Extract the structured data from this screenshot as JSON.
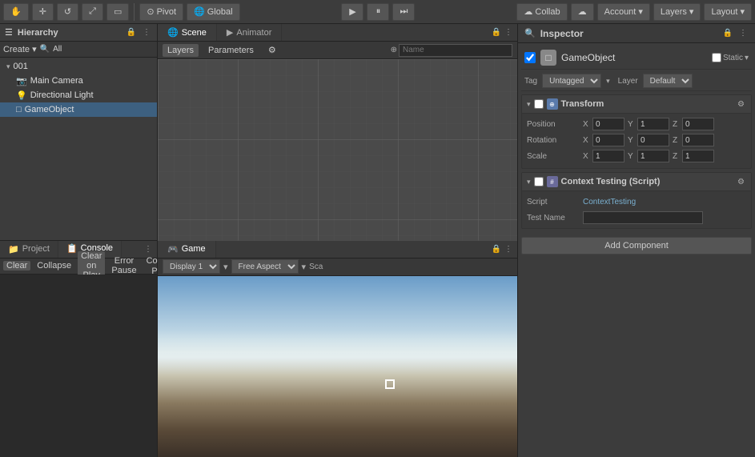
{
  "toolbar": {
    "pivot_label": "Pivot",
    "global_label": "Global",
    "account_label": "Account",
    "layers_label": "Layers",
    "layout_label": "Layout",
    "collab_label": "Collab"
  },
  "hierarchy": {
    "title": "Hierarchy",
    "create_label": "Create",
    "all_label": "All",
    "items": [
      {
        "label": "001",
        "indent": 0,
        "arrow": true
      },
      {
        "label": "Main Camera",
        "indent": 1,
        "arrow": false
      },
      {
        "label": "Directional Light",
        "indent": 1,
        "arrow": false
      },
      {
        "label": "GameObject",
        "indent": 1,
        "arrow": false,
        "selected": true
      }
    ]
  },
  "scene": {
    "title": "Scene",
    "layers_label": "Layers",
    "parameters_label": "Parameters",
    "search_placeholder": "Name"
  },
  "animator": {
    "title": "Animator"
  },
  "project": {
    "title": "Project"
  },
  "console": {
    "title": "Console",
    "clear_label": "Clear",
    "collapse_label": "Collapse",
    "clear_on_play_label": "Clear on Play",
    "error_pause_label": "Error Pause",
    "connected_player_label": "Connected Player"
  },
  "game": {
    "title": "Game",
    "display_label": "Display 1",
    "aspect_label": "Free Aspect",
    "scale_label": "Sca"
  },
  "inspector": {
    "title": "Inspector",
    "gameobject_name": "GameObject",
    "static_label": "Static",
    "tag_label": "Tag",
    "tag_value": "Untagged",
    "layer_label": "Layer",
    "layer_value": "Default",
    "transform": {
      "title": "Transform",
      "position_label": "Position",
      "rotation_label": "Rotation",
      "scale_label": "Scale",
      "px": "0",
      "py": "1",
      "pz": "0",
      "rx": "0",
      "ry": "0",
      "rz": "0",
      "sx": "1",
      "sy": "1",
      "sz": "1"
    },
    "context_testing": {
      "title": "Context Testing (Script)",
      "script_label": "Script",
      "script_value": "ContextTesting",
      "test_name_label": "Test Name"
    },
    "add_component_label": "Add Component"
  }
}
